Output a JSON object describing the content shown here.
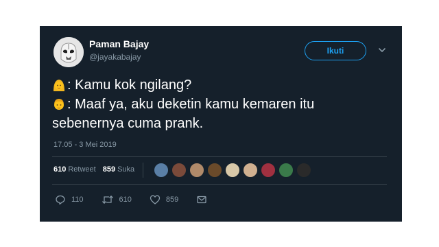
{
  "tweet": {
    "author_name": "Paman Bajay",
    "author_handle": "@jayakabajay",
    "follow_label": "Ikuti",
    "lines": [
      "Kamu kok ngilang?",
      "Maaf ya, aku deketin kamu kemaren itu",
      "sebenernya cuma prank."
    ],
    "timestamp": "17.05 - 3 Mei 2019",
    "retweet_count": "610",
    "retweet_label": "Retweet",
    "like_count": "859",
    "like_label": "Suka",
    "reply_count": "110",
    "retweet_action_count": "610",
    "like_action_count": "859"
  },
  "colors": {
    "background": "#15202b",
    "accent": "#1da1f2",
    "muted": "#8899a6",
    "divider": "#38444d"
  },
  "icons": [
    "stormtrooper-avatar-icon",
    "chevron-down-icon",
    "woman-emoji-icon",
    "man-emoji-icon",
    "reply-icon",
    "retweet-icon",
    "heart-icon",
    "message-icon"
  ],
  "liker_avatar_colors": [
    "#5a7fa6",
    "#7a4a3a",
    "#b08a6a",
    "#6a4a2a",
    "#d8c8a8",
    "#d0b090",
    "#a03040",
    "#3a7a4a",
    "#2a2a2a"
  ]
}
